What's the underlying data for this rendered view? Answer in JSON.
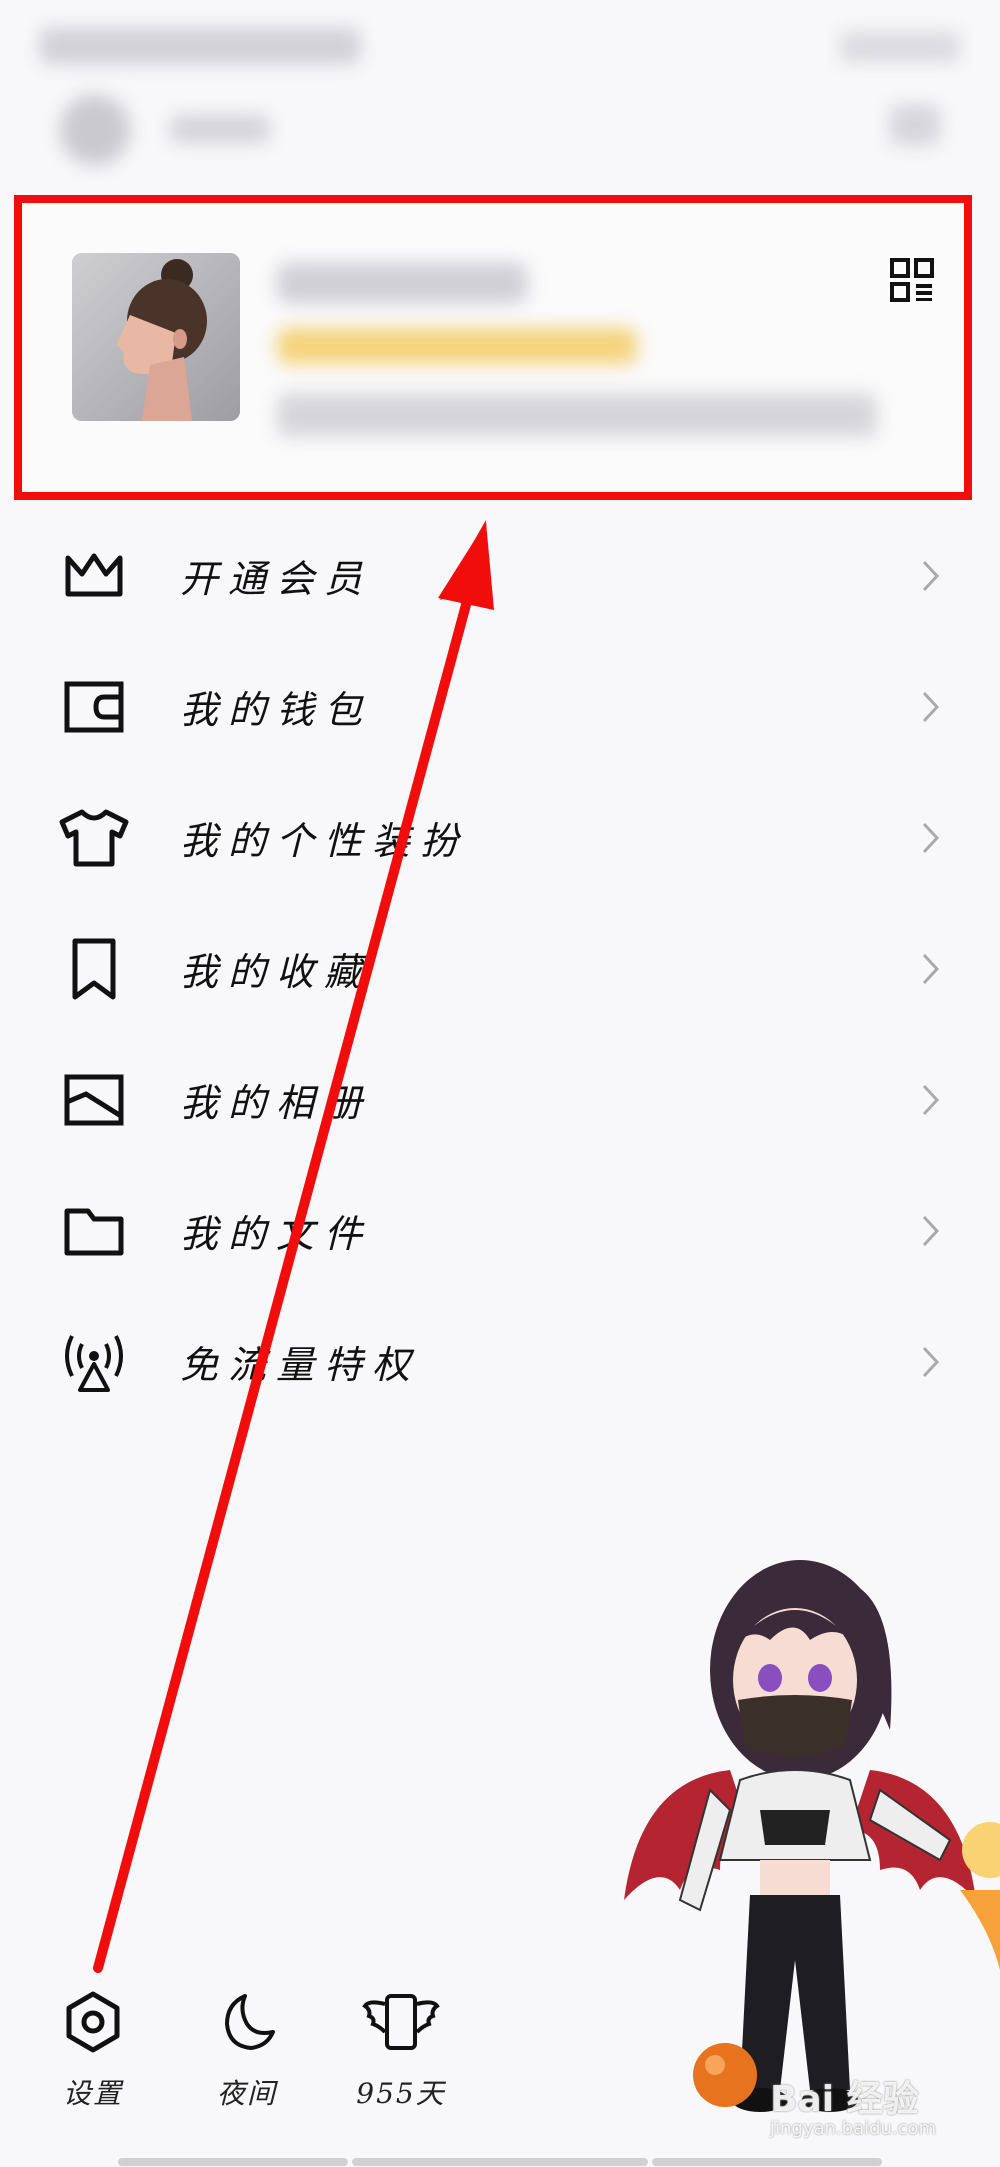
{
  "menu": {
    "items": [
      {
        "label": "开通会员",
        "icon": "crown-icon"
      },
      {
        "label": "我的钱包",
        "icon": "wallet-icon"
      },
      {
        "label": "我的个性装扮",
        "icon": "tshirt-icon"
      },
      {
        "label": "我的收藏",
        "icon": "bookmark-icon"
      },
      {
        "label": "我的相册",
        "icon": "photo-album-icon"
      },
      {
        "label": "我的文件",
        "icon": "folder-icon"
      },
      {
        "label": "免流量特权",
        "icon": "signal-tower-icon"
      }
    ]
  },
  "bottom_bar": {
    "settings_label": "设置",
    "night_label": "夜间",
    "days_label": "955天"
  },
  "watermark": {
    "text": "Bai 经验",
    "url": "jingyan.baidu.com"
  },
  "colors": {
    "highlight": "#f20d0d",
    "background": "#f8f8fa"
  }
}
